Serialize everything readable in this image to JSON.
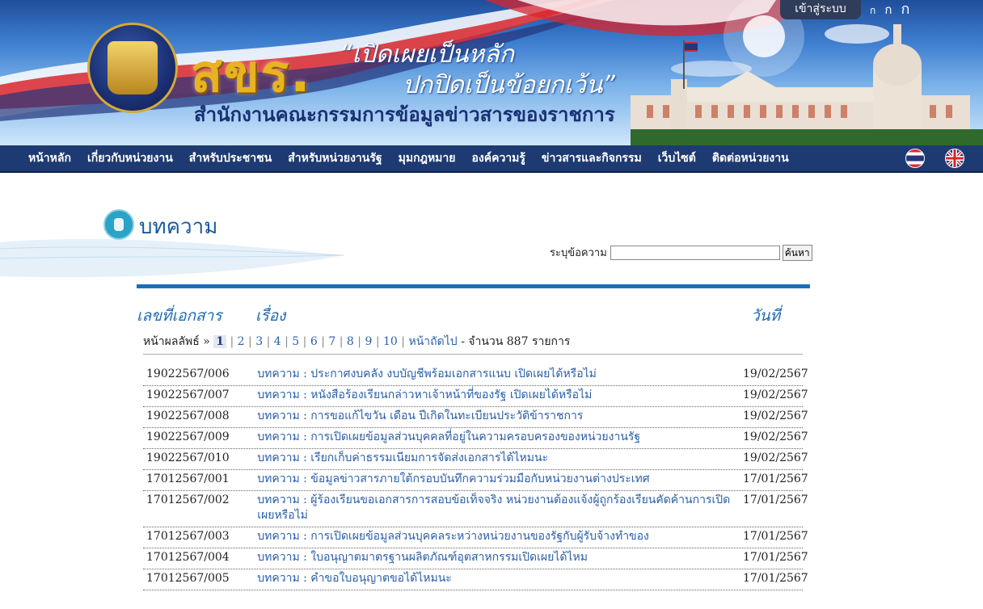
{
  "header": {
    "logo_text": "สขร.",
    "slogan_line1": "“เปิดเผยเป็นหลัก",
    "slogan_line2": "ปกปิดเป็นข้อยกเว้น”",
    "org_name": "สำนักงานคณะกรรมการข้อมูลข่าวสารของราชการ",
    "login_label": "เข้าสู่ระบบ",
    "font_size_options": [
      "ก",
      "ก",
      "ก"
    ]
  },
  "nav": {
    "items": [
      "หน้าหลัก",
      "เกี่ยวกับหน่วยงาน",
      "สำหรับประชาชน",
      "สำหรับหน่วยงานรัฐ",
      "มุมกฎหมาย",
      "องค์ความรู้",
      "ข่าวสารและกิจกรรม",
      "เว็บไซต์",
      "ติดต่อหน่วยงาน"
    ]
  },
  "page": {
    "title": "บทความ",
    "search_label": "ระบุข้อความ",
    "search_value": "",
    "search_button": "ค้นหา"
  },
  "columns": {
    "doc_no": "เลขที่เอกสาร",
    "subject": "เรื่อง",
    "date": "วันที่"
  },
  "pager": {
    "label": "หน้าผลลัพธ์ »",
    "current": "1",
    "pages": [
      "2",
      "3",
      "4",
      "5",
      "6",
      "7",
      "8",
      "9",
      "10"
    ],
    "next": "หน้าถัดไป",
    "summary": "- จำนวน 887 รายการ"
  },
  "rows": [
    {
      "doc": "19022567/006",
      "subject": "บทความ : ประกาศงบคลัง งบบัญชีพร้อมเอกสารแนบ เปิดเผยได้หรือไม่",
      "date": "19/02/2567"
    },
    {
      "doc": "19022567/007",
      "subject": "บทความ : หนังสือร้องเรียนกล่าวหาเจ้าหน้าที่ของรัฐ เปิดเผยได้หรือไม่",
      "date": "19/02/2567"
    },
    {
      "doc": "19022567/008",
      "subject": "บทความ : การขอแก้ไขวัน เดือน ปีเกิดในทะเบียนประวัติข้าราชการ",
      "date": "19/02/2567"
    },
    {
      "doc": "19022567/009",
      "subject": "บทความ : การเปิดเผยข้อมูลส่วนบุคคลที่อยู่ในความครอบครองของหน่วยงานรัฐ",
      "date": "19/02/2567"
    },
    {
      "doc": "19022567/010",
      "subject": "บทความ : เรียกเก็บค่าธรรมเนียมการจัดส่งเอกสารได้ไหมนะ",
      "date": "19/02/2567"
    },
    {
      "doc": "17012567/001",
      "subject": "บทความ : ข้อมูลข่าวสารภายใต้กรอบบันทึกความร่วมมือกับหน่วยงานต่างประเทศ",
      "date": "17/01/2567"
    },
    {
      "doc": "17012567/002",
      "subject": "บทความ : ผู้ร้องเรียนขอเอกสารการสอบข้อเท็จจริง หน่วยงานต้องแจ้งผู้ถูกร้องเรียนคัดค้านการเปิดเผยหรือไม่",
      "date": "17/01/2567"
    },
    {
      "doc": "17012567/003",
      "subject": "บทความ : การเปิดเผยข้อมูลส่วนบุคคลระหว่างหน่วยงานของรัฐกับผู้รับจ้างทำของ",
      "date": "17/01/2567"
    },
    {
      "doc": "17012567/004",
      "subject": "บทความ : ใบอนุญาตมาตรฐานผลิตภัณฑ์อุตสาหกรรมเปิดเผยได้ไหม",
      "date": "17/01/2567"
    },
    {
      "doc": "17012567/005",
      "subject": "บทความ : คำขอใบอนุญาตขอได้ไหมนะ",
      "date": "17/01/2567"
    }
  ]
}
